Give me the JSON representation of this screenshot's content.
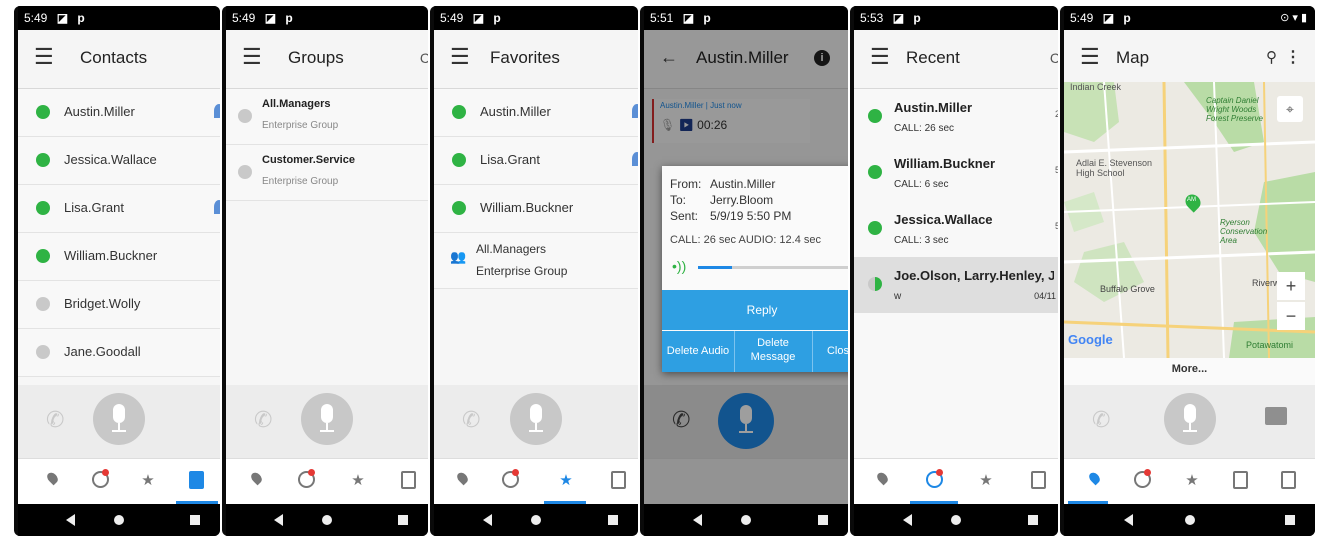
{
  "colors": {
    "online": "#2fb344",
    "offline": "#c9c9c9",
    "accent": "#1e88e5",
    "dialog_blue": "#2e9fe2"
  },
  "screens": {
    "contacts": {
      "time": "5:49",
      "status_icons": "◪ p",
      "title": "Contacts",
      "rows": [
        {
          "name": "Austin.Miller",
          "status": "online",
          "pin": true
        },
        {
          "name": "Jessica.Wallace",
          "status": "online",
          "pin": false
        },
        {
          "name": "Lisa.Grant",
          "status": "online",
          "pin": true
        },
        {
          "name": "William.Buckner",
          "status": "online",
          "pin": false
        },
        {
          "name": "Bridget.Wolly",
          "status": "offline",
          "pin": false
        },
        {
          "name": "Jane.Goodall",
          "status": "offline",
          "pin": false
        }
      ]
    },
    "groups": {
      "time": "5:49",
      "status_icons": "◪ p",
      "title": "Groups",
      "rows": [
        {
          "name": "All.Managers",
          "sub": "Enterprise Group"
        },
        {
          "name": "Customer.Service",
          "sub": "Enterprise Group"
        }
      ]
    },
    "favorites": {
      "time": "5:49",
      "status_icons": "◪ p",
      "title": "Favorites",
      "rows": [
        {
          "name": "Austin.Miller",
          "status": "online"
        },
        {
          "name": "Lisa.Grant",
          "status": "online"
        },
        {
          "name": "William.Buckner",
          "status": "online"
        }
      ],
      "group_row": {
        "name": "All.Managers",
        "sub": "Enterprise Group"
      }
    },
    "message": {
      "time": "5:51",
      "status_icons": "◪ p",
      "title": "Austin.Miller",
      "bubble": {
        "header": "Austin.Miller | Just now",
        "duration": "00:26"
      },
      "dialog": {
        "from_label": "From:",
        "from": "Austin.Miller",
        "to_label": "To:",
        "to": "Jerry.Bloom",
        "sent_label": "Sent:",
        "sent": "5/9/19 5:50 PM",
        "summary": "CALL: 26 sec AUDIO: 12.4 sec",
        "reply": "Reply",
        "delete_audio": "Delete Audio",
        "delete_message": "Delete Message",
        "close": "Clos"
      }
    },
    "recent": {
      "time": "5:53",
      "status_icons": "◪ p",
      "title": "Recent",
      "rows": [
        {
          "name": "Austin.Miller",
          "sub": "CALL: 26 sec",
          "status": "online",
          "edge": "2"
        },
        {
          "name": "William.Buckner",
          "sub": "CALL: 6 sec",
          "status": "online",
          "edge": "5"
        },
        {
          "name": "Jessica.Wallace",
          "sub": "CALL: 3 sec",
          "status": "online",
          "edge": "5"
        }
      ],
      "selected": {
        "name": "Joe.Olson, Larry.Henley, Jan...",
        "sub": "w",
        "date": "04/11"
      }
    },
    "map": {
      "time": "5:49",
      "status_icons": "◪ p",
      "title": "Map",
      "status_right": "⊙ ▾ ▮",
      "labels": {
        "indian_creek": "Indian Creek",
        "captain_daniel": "Captain Daniel Wright Woods Forest Preserve",
        "stevenson": "Adlai E. Stevenson High School",
        "ryerson": "Ryerson Conservation Area",
        "buffalo_grove": "Buffalo Grove",
        "riverwoods": "Riverwoods",
        "potawatomi": "Potawatomi",
        "google": "Google",
        "marker": "AM"
      },
      "more": "More..."
    }
  }
}
